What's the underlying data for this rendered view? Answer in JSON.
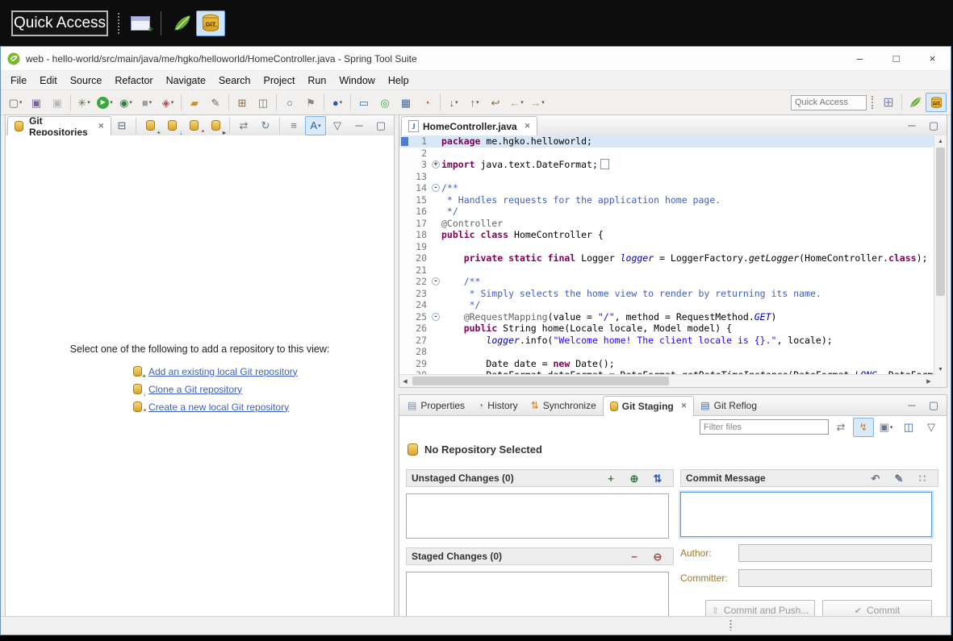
{
  "magnifier": {
    "quick_access": "Quick Access",
    "git_badge": "GIT"
  },
  "window": {
    "title": "web - hello-world/src/main/java/me/hgko/helloworld/HomeController.java - Spring Tool Suite",
    "minimize": "–",
    "maximize": "□",
    "close": "×"
  },
  "menu": [
    "File",
    "Edit",
    "Source",
    "Refactor",
    "Navigate",
    "Search",
    "Project",
    "Run",
    "Window",
    "Help"
  ],
  "toolbar": {
    "quick_access": "Quick Access",
    "buttons": [
      {
        "name": "new-wizard-button",
        "glyph": "▢",
        "color": "#666666",
        "dd": true
      },
      {
        "name": "save-button",
        "glyph": "▣",
        "color": "#7a5fa0"
      },
      {
        "name": "save-all-button",
        "glyph": "▣",
        "color": "#b8b8b8"
      },
      {
        "sep": true
      },
      {
        "name": "debug-button",
        "glyph": "✳",
        "color": "#557a2f",
        "dd": true
      },
      {
        "name": "run-button",
        "glyph": "▶",
        "color": "#ffffff",
        "bg": "#39a83e",
        "round": true,
        "dd": true
      },
      {
        "name": "profile-button",
        "glyph": "◉",
        "color": "#2e7d32",
        "dd": true
      },
      {
        "name": "terminate-button",
        "glyph": "■",
        "color": "#a0a0a0",
        "dd": true
      },
      {
        "name": "external-tools-button",
        "glyph": "◈",
        "color": "#b05050",
        "dd": true
      },
      {
        "sep": true
      },
      {
        "name": "import-button",
        "glyph": "▰",
        "color": "#c8922a"
      },
      {
        "name": "edit-config-button",
        "glyph": "✎",
        "color": "#6b6b6b"
      },
      {
        "sep": true
      },
      {
        "name": "new-project-button",
        "glyph": "⊞",
        "color": "#8a6d3b"
      },
      {
        "name": "jar-button",
        "glyph": "◫",
        "color": "#777777"
      },
      {
        "sep": true
      },
      {
        "name": "search-button",
        "glyph": "○",
        "color": "#4a6b8a"
      },
      {
        "name": "mark-occurrences-button",
        "glyph": "⚑",
        "color": "#888888"
      },
      {
        "sep": true
      },
      {
        "name": "user-account-button",
        "glyph": "●",
        "color": "#2a5db0",
        "dd": true
      },
      {
        "sep": true
      },
      {
        "name": "console-button",
        "glyph": "▭",
        "color": "#3a6ea5"
      },
      {
        "name": "spring-boot-button",
        "glyph": "◎",
        "color": "#39a83e"
      },
      {
        "name": "dashboard-button",
        "glyph": "▦",
        "color": "#3a6ea5"
      },
      {
        "name": "clock-button",
        "glyph": "◔",
        "color": "#d2691e"
      },
      {
        "sep": true
      },
      {
        "name": "next-annotation-button",
        "glyph": "↓",
        "color": "#666666",
        "dd": true
      },
      {
        "name": "prev-annotation-button",
        "glyph": "↑",
        "color": "#666666",
        "dd": true
      },
      {
        "name": "last-edit-button",
        "glyph": "↩",
        "color": "#8a6d3b"
      },
      {
        "name": "back-button",
        "glyph": "←",
        "color": "#c9a227",
        "dd": true
      },
      {
        "name": "forward-button",
        "glyph": "→",
        "color": "#c9a227",
        "dd": true
      }
    ]
  },
  "repo_view": {
    "tab": "Git Repositories",
    "message": "Select one of the following to add a repository to this view:",
    "links": [
      {
        "label": "Add an existing local Git repository",
        "badge": "+",
        "badgeColor": "#2e7d32"
      },
      {
        "label": "Clone a Git repository",
        "badge": "↓",
        "badgeColor": "#2a5db0"
      },
      {
        "label": "Create a new local Git repository",
        "badge": "*",
        "badgeColor": "#c0392b"
      }
    ],
    "toolbar": [
      {
        "name": "collapse-all-button",
        "glyph": "⊟",
        "color": "#556677"
      },
      {
        "sep": true
      },
      {
        "name": "add-repo-button",
        "cyl": true,
        "badge": "+",
        "badgeColor": "#2e7d32"
      },
      {
        "name": "clone-repo-button",
        "cyl": true,
        "badge": "↓",
        "badgeColor": "#2a5db0"
      },
      {
        "name": "create-repo-button",
        "cyl": true,
        "badge": "*",
        "badgeColor": "#c0392b"
      },
      {
        "name": "repo-groups-button",
        "cyl": true,
        "badge": "▸",
        "badgeColor": "#555555"
      },
      {
        "sep": true
      },
      {
        "name": "link-selection-button",
        "glyph": "⇄",
        "color": "#667788"
      },
      {
        "name": "refresh-button",
        "glyph": "↻",
        "color": "#667788"
      },
      {
        "sep": true
      },
      {
        "name": "hierarchy-button",
        "glyph": "≡",
        "color": "#667788"
      },
      {
        "name": "sort-toggle-button",
        "glyph": "A",
        "color": "#2a5db0",
        "active": true,
        "dd": true
      },
      {
        "name": "view-menu-button",
        "glyph": "▽",
        "color": "#556677"
      },
      {
        "name": "minimize-view-button",
        "glyph": "─",
        "color": "#556677"
      },
      {
        "name": "maximize-view-button",
        "glyph": "▢",
        "color": "#556677"
      }
    ]
  },
  "editor": {
    "tab": "HomeController.java",
    "controls": [
      {
        "name": "minimize-editor-button",
        "glyph": "─",
        "color": "#556677"
      },
      {
        "name": "maximize-editor-button",
        "glyph": "▢",
        "color": "#556677"
      }
    ],
    "lines": [
      {
        "n": "1",
        "hl": true,
        "seg": [
          [
            "k",
            "package"
          ],
          [
            "p",
            " me.hgko.helloworld;"
          ]
        ]
      },
      {
        "n": "2",
        "seg": []
      },
      {
        "n": "3",
        "f": "+",
        "box": true,
        "seg": [
          [
            "k",
            "import"
          ],
          [
            "p",
            " java.text.DateFormat;"
          ]
        ]
      },
      {
        "n": "13",
        "seg": []
      },
      {
        "n": "14",
        "f": "-",
        "seg": [
          [
            "j",
            "/**"
          ]
        ]
      },
      {
        "n": "15",
        "seg": [
          [
            "j",
            " * Handles requests for the application home page."
          ]
        ]
      },
      {
        "n": "16",
        "seg": [
          [
            "j",
            " */"
          ]
        ]
      },
      {
        "n": "17",
        "seg": [
          [
            "a",
            "@Controller"
          ]
        ]
      },
      {
        "n": "18",
        "seg": [
          [
            "k",
            "public"
          ],
          [
            "p",
            " "
          ],
          [
            "k",
            "class"
          ],
          [
            "p",
            " HomeController {"
          ]
        ]
      },
      {
        "n": "19",
        "seg": []
      },
      {
        "n": "20",
        "seg": [
          [
            "p",
            "    "
          ],
          [
            "k",
            "private"
          ],
          [
            "p",
            " "
          ],
          [
            "k",
            "static"
          ],
          [
            "p",
            " "
          ],
          [
            "k",
            "final"
          ],
          [
            "p",
            " Logger "
          ],
          [
            "f",
            "logger"
          ],
          [
            "p",
            " = LoggerFactory."
          ],
          [
            "m",
            "getLogger"
          ],
          [
            "p",
            "(HomeController."
          ],
          [
            "k",
            "class"
          ],
          [
            "p",
            ");"
          ]
        ]
      },
      {
        "n": "21",
        "seg": []
      },
      {
        "n": "22",
        "f": "-",
        "seg": [
          [
            "p",
            "    "
          ],
          [
            "j",
            "/**"
          ]
        ]
      },
      {
        "n": "23",
        "seg": [
          [
            "j",
            "     * Simply selects the home view to render by returning its name."
          ]
        ]
      },
      {
        "n": "24",
        "seg": [
          [
            "j",
            "     */"
          ]
        ]
      },
      {
        "n": "25",
        "f": "-",
        "seg": [
          [
            "p",
            "    "
          ],
          [
            "a",
            "@RequestMapping"
          ],
          [
            "p",
            "(value = "
          ],
          [
            "s",
            "\"/\""
          ],
          [
            "p",
            ", method = RequestMethod."
          ],
          [
            "f",
            "GET"
          ],
          [
            "p",
            ")"
          ]
        ]
      },
      {
        "n": "26",
        "seg": [
          [
            "p",
            "    "
          ],
          [
            "k",
            "public"
          ],
          [
            "p",
            " String home(Locale locale, Model model) {"
          ]
        ]
      },
      {
        "n": "27",
        "seg": [
          [
            "p",
            "        "
          ],
          [
            "f",
            "logger"
          ],
          [
            "p",
            ".info("
          ],
          [
            "s",
            "\"Welcome home! The client locale is {}.\""
          ],
          [
            "p",
            ", locale);"
          ]
        ]
      },
      {
        "n": "28",
        "seg": []
      },
      {
        "n": "29",
        "seg": [
          [
            "p",
            "        Date date = "
          ],
          [
            "k",
            "new"
          ],
          [
            "p",
            " Date();"
          ]
        ]
      },
      {
        "n": "30",
        "seg": [
          [
            "p",
            "        DateFormat dateFormat = DateFormat."
          ],
          [
            "m",
            "getDateTimeInstance"
          ],
          [
            "p",
            "(DateFormat."
          ],
          [
            "f",
            "LONG"
          ],
          [
            "p",
            ", DateFormat"
          ]
        ]
      }
    ]
  },
  "staging": {
    "tabs": [
      {
        "label": "Properties",
        "icon": "▤",
        "iconColor": "#7a8aa0"
      },
      {
        "label": "History",
        "icon": "◔",
        "iconColor": "#777777"
      },
      {
        "label": "Synchronize",
        "icon": "⇅",
        "iconColor": "#c08030"
      },
      {
        "label": "Git Staging",
        "icon": "cyl",
        "selected": true
      },
      {
        "label": "Git Reflog",
        "icon": "▤",
        "iconColor": "#3a6ea5"
      }
    ],
    "tab_controls": [
      {
        "name": "minimize-staging-button",
        "glyph": "─",
        "color": "#556677"
      },
      {
        "name": "maximize-staging-button",
        "glyph": "▢",
        "color": "#556677"
      }
    ],
    "filter_icons": [
      {
        "name": "compare-mode-button",
        "glyph": "⇄",
        "color": "#667788"
      },
      {
        "name": "switch-repo-button",
        "glyph": "↯",
        "color": "#c98a1a",
        "active": true
      },
      {
        "name": "paste-patch-button",
        "glyph": "▣",
        "color": "#667788",
        "dd": true
      },
      {
        "name": "layout-button",
        "glyph": "◫",
        "color": "#2a5db0"
      },
      {
        "name": "staging-view-menu-button",
        "glyph": "▽",
        "color": "#556677"
      }
    ],
    "unstaged_icons": [
      {
        "name": "stage-selected-button",
        "glyph": "+",
        "color": "#3a7d44"
      },
      {
        "name": "stage-all-button",
        "glyph": "⊕",
        "color": "#3a7d44"
      },
      {
        "name": "sort-files-button",
        "glyph": "⇅",
        "color": "#2a5db0"
      }
    ],
    "staged_icons": [
      {
        "name": "unstage-selected-button",
        "glyph": "−",
        "color": "#a05050"
      },
      {
        "name": "unstage-all-button",
        "glyph": "⊖",
        "color": "#a05050"
      }
    ],
    "commit_icons": [
      {
        "name": "amend-button",
        "glyph": "↶",
        "color": "#667788"
      },
      {
        "name": "sign-off-button",
        "glyph": "✎",
        "color": "#667788"
      },
      {
        "name": "more-handle",
        "glyph": "∷",
        "color": "#999999"
      }
    ],
    "filter_placeholder": "Filter files",
    "heading": "No Repository Selected",
    "unstaged_title": "Unstaged Changes (0)",
    "staged_title": "Staged Changes (0)",
    "commit_title": "Commit Message",
    "author_label": "Author:",
    "committer_label": "Committer:",
    "commit_push_label": "Commit and Push...",
    "commit_push_icon": "⇧",
    "commit_label": "Commit",
    "commit_icon": "✔"
  }
}
